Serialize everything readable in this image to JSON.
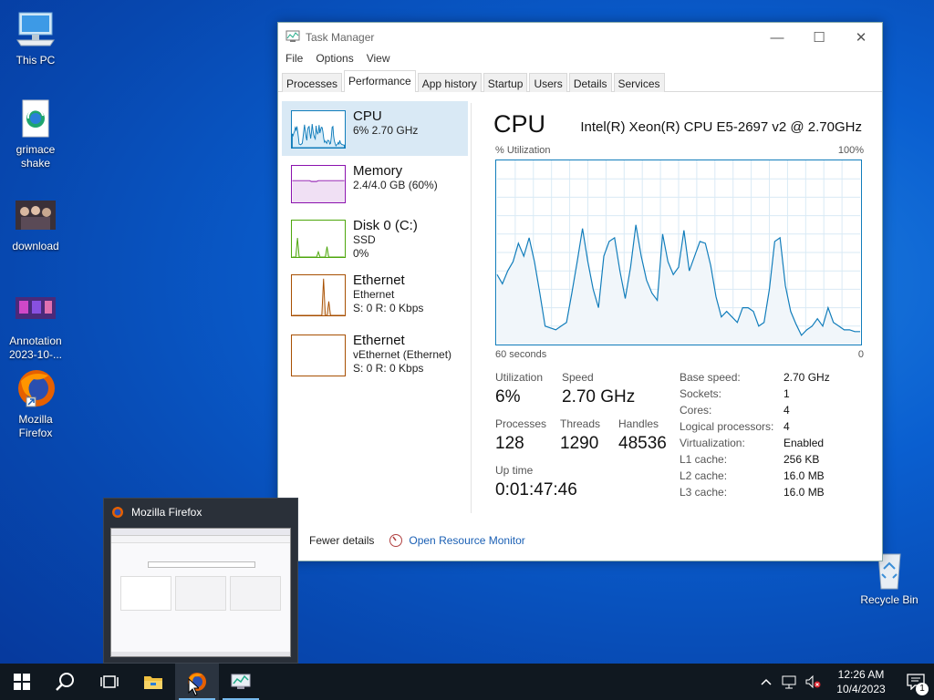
{
  "desktop": {
    "icons": [
      {
        "label": "This PC"
      },
      {
        "label": "grimace shake"
      },
      {
        "label": "download"
      },
      {
        "label": "Annotation 2023-10-..."
      },
      {
        "label": "Mozilla Firefox"
      },
      {
        "label": "Recycle Bin"
      }
    ]
  },
  "taskmanager": {
    "title": "Task Manager",
    "menu": [
      "File",
      "Options",
      "View"
    ],
    "tabs": [
      "Processes",
      "Performance",
      "App history",
      "Startup",
      "Users",
      "Details",
      "Services"
    ],
    "active_tab": "Performance",
    "resources": [
      {
        "name": "CPU",
        "sub1": "6% 2.70 GHz",
        "sub2": "",
        "color": "#117dbb"
      },
      {
        "name": "Memory",
        "sub1": "2.4/4.0 GB (60%)",
        "sub2": "",
        "color": "#8b12ae"
      },
      {
        "name": "Disk 0 (C:)",
        "sub1": "SSD",
        "sub2": "0%",
        "color": "#4da60c"
      },
      {
        "name": "Ethernet",
        "sub1": "Ethernet",
        "sub2": "S: 0 R: 0 Kbps",
        "color": "#a74f01"
      },
      {
        "name": "Ethernet",
        "sub1": "vEthernet (Ethernet)",
        "sub2": "S: 0 R: 0 Kbps",
        "color": "#a74f01"
      }
    ],
    "cpu": {
      "title": "CPU",
      "model": "Intel(R) Xeon(R) CPU E5-2697 v2 @ 2.70GHz",
      "util_label": "% Utilization",
      "max_label": "100%",
      "time_label": "60 seconds",
      "min_label": "0",
      "stats": {
        "utilization_label": "Utilization",
        "utilization": "6%",
        "speed_label": "Speed",
        "speed": "2.70 GHz",
        "processes_label": "Processes",
        "processes": "128",
        "threads_label": "Threads",
        "threads": "1290",
        "handles_label": "Handles",
        "handles": "48536",
        "uptime_label": "Up time",
        "uptime": "0:01:47:46"
      },
      "specs": [
        {
          "key": "Base speed:",
          "value": "2.70 GHz"
        },
        {
          "key": "Sockets:",
          "value": "1"
        },
        {
          "key": "Cores:",
          "value": "4"
        },
        {
          "key": "Logical processors:",
          "value": "4"
        },
        {
          "key": "Virtualization:",
          "value": "Enabled"
        },
        {
          "key": "L1 cache:",
          "value": "256 KB"
        },
        {
          "key": "L2 cache:",
          "value": "16.0 MB"
        },
        {
          "key": "L3 cache:",
          "value": "16.0 MB"
        }
      ],
      "history": [
        38,
        33,
        40,
        45,
        55,
        48,
        58,
        45,
        28,
        10,
        9,
        8,
        10,
        12,
        28,
        45,
        63,
        45,
        30,
        20,
        48,
        56,
        58,
        40,
        25,
        42,
        65,
        48,
        35,
        28,
        24,
        60,
        45,
        38,
        42,
        62,
        40,
        48,
        56,
        55,
        43,
        26,
        15,
        18,
        15,
        12,
        20,
        20,
        18,
        10,
        12,
        30,
        56,
        58,
        32,
        18,
        11,
        5,
        8,
        10,
        14,
        10,
        20,
        12,
        10,
        8,
        8,
        7,
        7
      ]
    },
    "footer": {
      "fewer_details": "Fewer details",
      "resource_monitor": "Open Resource Monitor"
    }
  },
  "preview": {
    "title": "Mozilla Firefox"
  },
  "taskbar": {
    "time": "12:26 AM",
    "date": "10/4/2023",
    "notification_count": "1"
  }
}
